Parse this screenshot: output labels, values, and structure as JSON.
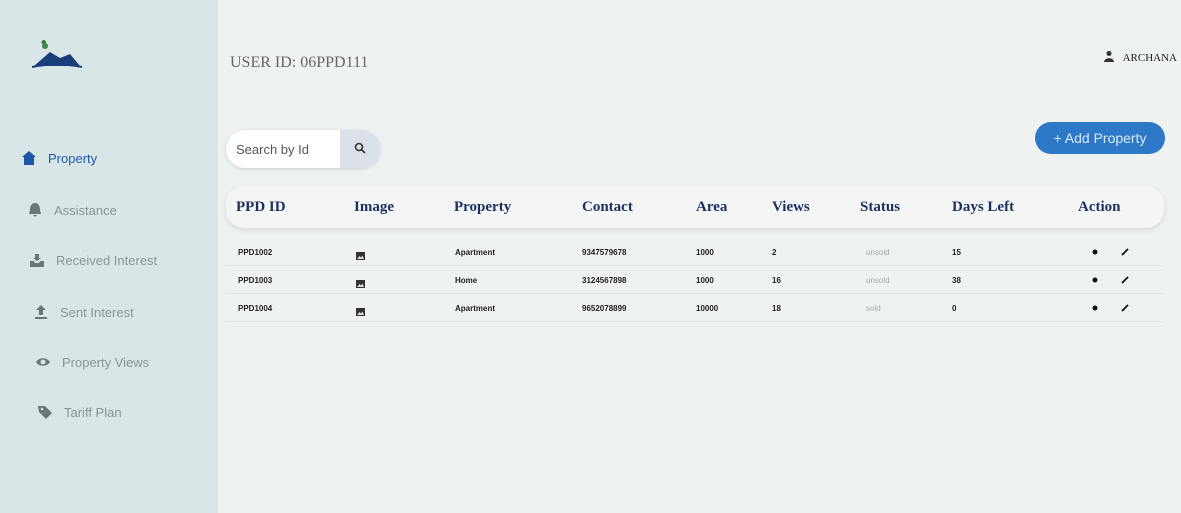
{
  "sidebar": {
    "items": [
      {
        "label": "Property",
        "icon": "home-icon"
      },
      {
        "label": "Assistance",
        "icon": "bell-icon"
      },
      {
        "label": "Received Interest",
        "icon": "inbox-icon"
      },
      {
        "label": "Sent Interest",
        "icon": "upload-icon"
      },
      {
        "label": "Property Views",
        "icon": "eye-icon"
      },
      {
        "label": "Tariff Plan",
        "icon": "tag-icon"
      }
    ]
  },
  "header": {
    "user_id": "USER ID: 06PPD111",
    "user_name": "ARCHANA"
  },
  "search": {
    "placeholder": "Search by Id"
  },
  "add_button": "+ Add Property",
  "table": {
    "columns": [
      "PPD ID",
      "Image",
      "Property",
      "Contact",
      "Area",
      "Views",
      "Status",
      "Days Left",
      "Action"
    ],
    "rows": [
      {
        "id": "PPD1002",
        "property": "Apartment",
        "contact": "9347579678",
        "area": "1000",
        "views": "2",
        "status": "unsold",
        "days_left": "15"
      },
      {
        "id": "PPD1003",
        "property": "Home",
        "contact": "3124567898",
        "area": "1000",
        "views": "16",
        "status": "unsold",
        "days_left": "38"
      },
      {
        "id": "PPD1004",
        "property": "Apartment",
        "contact": "9652078899",
        "area": "10000",
        "views": "18",
        "status": "sold",
        "days_left": "0"
      }
    ]
  },
  "colors": {
    "accent": "#2e79c7",
    "header_text": "#1c2f5f",
    "sidebar_bg": "#d9e6e8"
  }
}
